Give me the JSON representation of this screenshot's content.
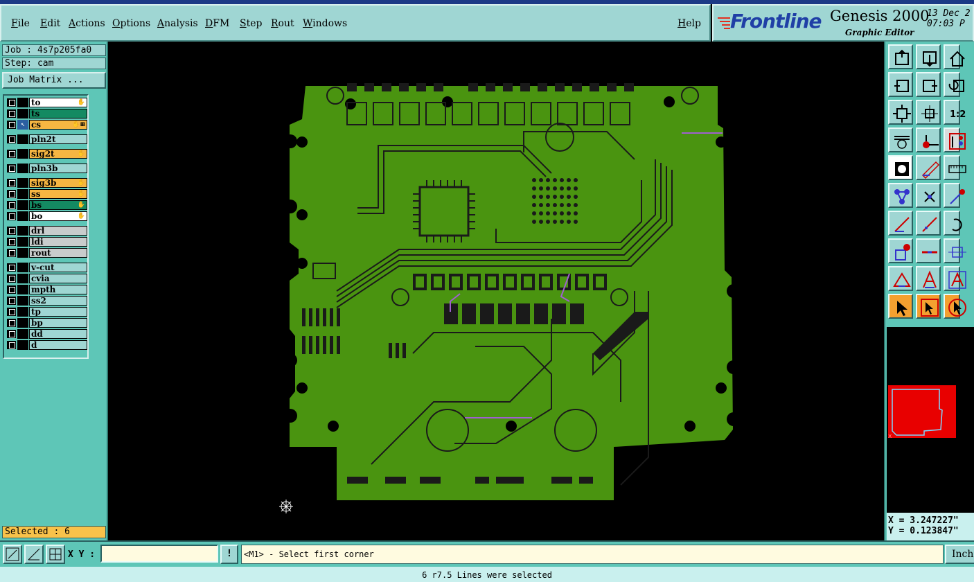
{
  "menu": {
    "items": [
      "File",
      "Edit",
      "Actions",
      "Options",
      "Analysis",
      "DFM",
      "Step",
      "Rout",
      "Windows"
    ],
    "help": "Help"
  },
  "brand": {
    "logo": "Frontline",
    "product": "Genesis 2000",
    "subtitle": "Graphic Editor",
    "date": "13 Dec 2",
    "time": "07:03 P"
  },
  "job": {
    "job_label": "Job : 4s7p205fa0",
    "step_label": "Step: cam",
    "matrix_button": "Job Matrix ..."
  },
  "layers": [
    {
      "name": "to",
      "color": "#ffffff",
      "mark": "✋",
      "affected": false
    },
    {
      "name": "ts",
      "color": "#148a62",
      "mark": "",
      "affected": false
    },
    {
      "name": "cs",
      "color": "#f6b642",
      "mark": "✋⊞",
      "affected": true
    },
    {
      "name": "pln2t",
      "color": "#9fd6d3",
      "mark": "",
      "affected": false
    },
    {
      "name": "sig2t",
      "color": "#f6b642",
      "mark": "✋",
      "affected": false
    },
    {
      "name": "pln3b",
      "color": "#9fd6d3",
      "mark": "",
      "affected": false
    },
    {
      "name": "sig3b",
      "color": "#f6b642",
      "mark": "✋",
      "affected": false
    },
    {
      "name": "ss",
      "color": "#f6b642",
      "mark": "✋",
      "affected": false
    },
    {
      "name": "bs",
      "color": "#148a62",
      "mark": "✋",
      "affected": false
    },
    {
      "name": "bo",
      "color": "#ffffff",
      "mark": "✋",
      "affected": false
    },
    {
      "name": "drl",
      "color": "#c8cccc",
      "mark": "",
      "affected": false
    },
    {
      "name": "ldi",
      "color": "#c8cccc",
      "mark": "",
      "affected": false
    },
    {
      "name": "rout",
      "color": "#c8cccc",
      "mark": "",
      "affected": false
    },
    {
      "name": "v-cut",
      "color": "#9fd6d3",
      "mark": "",
      "affected": false
    },
    {
      "name": "cvia",
      "color": "#9fd6d3",
      "mark": "",
      "affected": false
    },
    {
      "name": "mpth",
      "color": "#9fd6d3",
      "mark": "",
      "affected": false
    },
    {
      "name": "ss2",
      "color": "#9fd6d3",
      "mark": "",
      "affected": false
    },
    {
      "name": "tp",
      "color": "#9fd6d3",
      "mark": "",
      "affected": false
    },
    {
      "name": "bp",
      "color": "#9fd6d3",
      "mark": "",
      "affected": false
    },
    {
      "name": "dd",
      "color": "#9fd6d3",
      "mark": "",
      "affected": false
    },
    {
      "name": "d",
      "color": "#9fd6d3",
      "mark": "",
      "affected": false
    }
  ],
  "selected": "Selected : 6",
  "coords": {
    "x": "X = 3.247227\"",
    "y": "Y = 0.123847\""
  },
  "bottom": {
    "xy_label": "X Y :",
    "xy_value": "",
    "bang": "!",
    "prompt": "<M1> - Select first corner",
    "units": "Inch"
  },
  "status": "6 r7.5 Lines were selected",
  "colors": {
    "board": "#4a9410",
    "trace": "#1a1a1a",
    "selection": "#a060d0"
  },
  "icons": [
    "zoom-home-icon",
    "zoom-out-icon",
    "home-icon",
    "zoom-previous-icon",
    "zoom-next-icon",
    "undo-icon",
    "fit-all-icon",
    "fit-center-icon",
    "one-to-two-icon",
    "tool-settings-icon",
    "probe-icon",
    "layer-select-icon",
    "snapshot-icon",
    "measure-icon",
    "ruler-icon",
    "net-icon",
    "cross-icon",
    "point-icon",
    "line-add-icon",
    "line-edit-icon",
    "arc-icon",
    "pad-add-icon",
    "dash-icon",
    "frame-icon",
    "triangle-icon",
    "text-a-icon",
    "text-a-frame-icon",
    "pointer-icon",
    "pointer-box-icon",
    "pointer-circle-icon"
  ]
}
